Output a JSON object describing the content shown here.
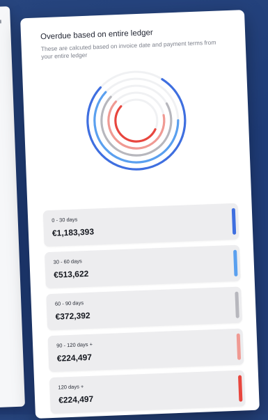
{
  "panel": {
    "title": "Overdue based on entire ledger",
    "subtitle": "These are calcuted based on invoice date and payment terms from your entire ledger"
  },
  "rings": [
    {
      "color": "#3f6fe0",
      "fraction": 0.78
    },
    {
      "color": "#5aa0ef",
      "fraction": 0.62
    },
    {
      "color": "#b7b7bd",
      "fraction": 0.7
    },
    {
      "color": "#f09a93",
      "fraction": 0.65
    },
    {
      "color": "#e8463e",
      "fraction": 0.55
    }
  ],
  "buckets": [
    {
      "label": "0 - 30 days",
      "amount": "€1,183,393",
      "color": "#3f6fe0"
    },
    {
      "label": "30 - 60 days",
      "amount": "€513,622",
      "color": "#5aa0ef"
    },
    {
      "label": "60 - 90 days",
      "amount": "€372,392",
      "color": "#b7b7bd"
    },
    {
      "label": "90 - 120 days +",
      "amount": "€224,497",
      "color": "#f09a93"
    },
    {
      "label": "120 days +",
      "amount": "€224,497",
      "color": "#e8463e"
    }
  ]
}
